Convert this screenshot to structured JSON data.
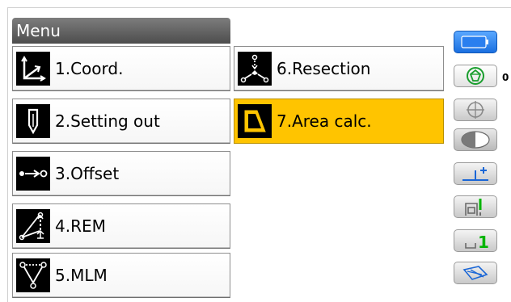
{
  "title": "Menu",
  "menu_items": [
    {
      "label": "1.Coord.",
      "icon": "coordinate-axes-icon",
      "selected": false
    },
    {
      "label": "2.Setting out",
      "icon": "setting-out-pin-icon",
      "selected": false
    },
    {
      "label": "3.Offset",
      "icon": "offset-arrow-icon",
      "selected": false
    },
    {
      "label": "4.REM",
      "icon": "remote-elevation-icon",
      "selected": false
    },
    {
      "label": "5.MLM",
      "icon": "missing-line-icon",
      "selected": false
    },
    {
      "label": "6.Resection",
      "icon": "resection-icon",
      "selected": false
    },
    {
      "label": "7.Area calc.",
      "icon": "area-calc-icon",
      "selected": true
    }
  ],
  "status_panel": {
    "battery_icon": "battery-icon",
    "target_icon": "prism-target-icon",
    "prism_constant": "0",
    "tilt_icon": "tilt-crosshair-icon",
    "laser_icon": "laser-pointer-icon",
    "input_mode_icon": "input-mode-icon",
    "edm_mode_icon": "edm-mode-icon",
    "page_icon": "page-number-icon",
    "page_number": "1",
    "keyboard_icon": "softkey-switch-icon"
  },
  "colors": {
    "selected": "#ffc400",
    "title_bar": "#5a5a5a",
    "battery": "#2a7fef",
    "target_green": "#1a9e2e",
    "accent_green": "#00b400"
  }
}
